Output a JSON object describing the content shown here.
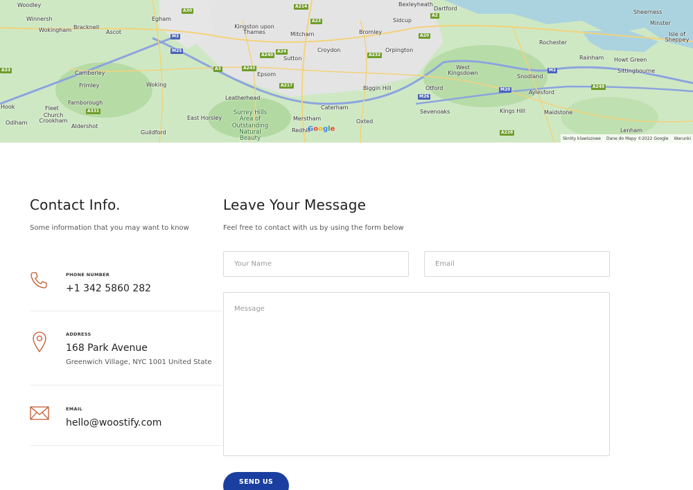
{
  "map": {
    "places": [
      "Woodley",
      "Winnersh",
      "Wokingham",
      "Bracknell",
      "Ascot",
      "Egham",
      "Kingston upon Thames",
      "Mitcham",
      "Croydon",
      "Bromley",
      "Sidcup",
      "Bexleyheath",
      "Dartford",
      "Sheerness",
      "Minster",
      "Isle of Sheppey",
      "Orpington",
      "Rochester",
      "Rainham",
      "Howt Green",
      "Sittingbourne",
      "Camberley",
      "Frimley",
      "Woking",
      "Sutton",
      "Epsom",
      "West Kingsdown",
      "Snodland",
      "Farnborough",
      "Fleet",
      "Church Crookham",
      "Aldershot",
      "Leatherhead",
      "Biggin Hill",
      "Otford",
      "Aylesford",
      "Hook",
      "Odiham",
      "Caterham",
      "Sevenoaks",
      "Kings Hill",
      "Maidstone",
      "East Horsley",
      "Surrey Hills Area of Outstanding Natural Beauty",
      "Merstham",
      "Redhill",
      "Oxted",
      "Guildford",
      "Lenham"
    ],
    "roads": [
      "A30",
      "A214",
      "A23",
      "A2",
      "M3",
      "M25",
      "A240",
      "A24",
      "A232",
      "A20",
      "A3",
      "A243",
      "A33",
      "M2",
      "A217",
      "M26",
      "M20",
      "A249",
      "A331",
      "A228"
    ],
    "attribution": [
      "Skróty klawiszowe",
      "Dane do Mapy ©2022 Google",
      "Warunki"
    ],
    "logo": "Google"
  },
  "contact": {
    "title": "Contact Info.",
    "subtitle": "Some information that you may want to know",
    "phone": {
      "label": "PHONE NUMBER",
      "value": "+1 342 5860 282",
      "icon": "phone-icon"
    },
    "address": {
      "label": "ADDRESS",
      "value": "168 Park Avenue",
      "extra": "Greenwich Village, NYC 1001 United State",
      "icon": "location-pin-icon"
    },
    "email": {
      "label": "EMAIL",
      "value": "hello@woostify.com",
      "icon": "envelope-icon"
    }
  },
  "form": {
    "title": "Leave Your Message",
    "subtitle": "Feel free to contact with us by using the form below",
    "name_placeholder": "Your Name",
    "email_placeholder": "Email",
    "message_placeholder": "Message",
    "submit_label": "SEND US"
  },
  "colors": {
    "accent": "#c0582e",
    "button": "#1b3fa0",
    "map_green": "#cfe8c4",
    "map_water": "#aad3df"
  }
}
